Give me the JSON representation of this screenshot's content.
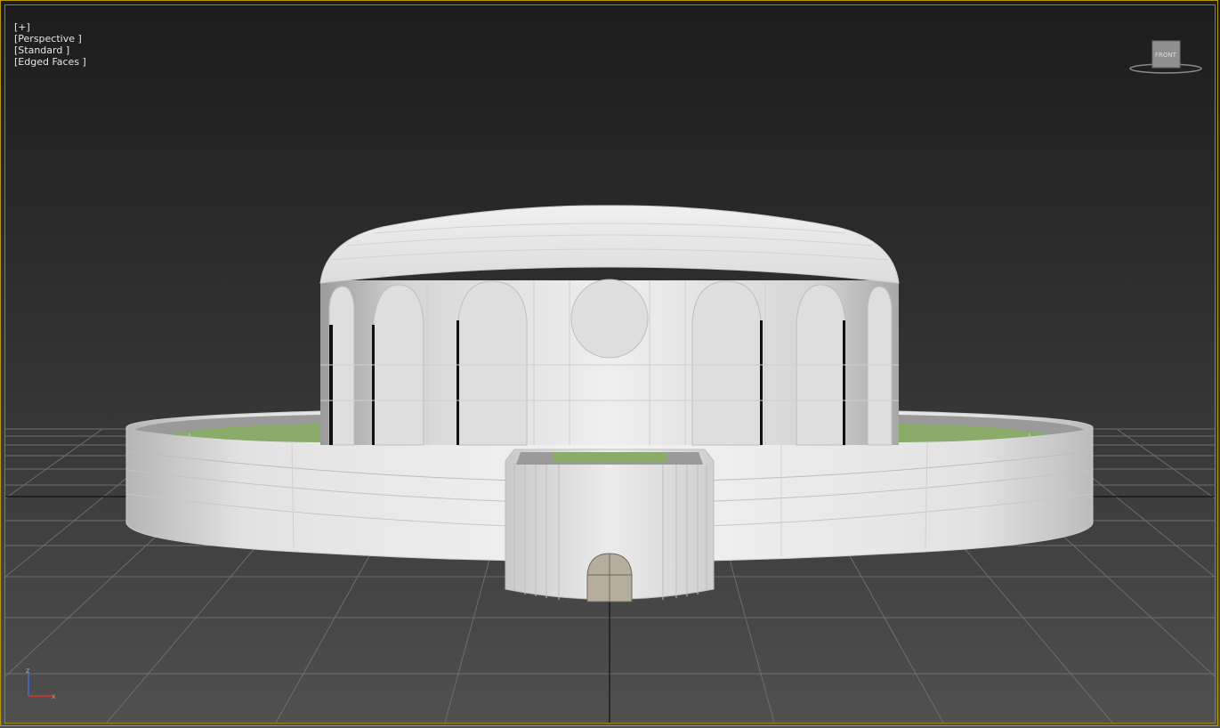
{
  "viewport": {
    "label_plus": "[+]",
    "label_view": "[Perspective ]",
    "label_shading": "[Standard ]",
    "label_edges": "[Edged Faces ]"
  },
  "viewcube": {
    "face_label": "FRONT"
  },
  "axis_gizmo": {
    "z_label": "z",
    "x_label": "x"
  },
  "colors": {
    "frame": "#c8a400",
    "background_top": "#1f1f1f",
    "background_bottom": "#4a4a4a",
    "grid": "#7a7a7a",
    "model_white": "#e8e8e8",
    "grass_green": "#8aab6a",
    "door": "#b7ad9f"
  }
}
